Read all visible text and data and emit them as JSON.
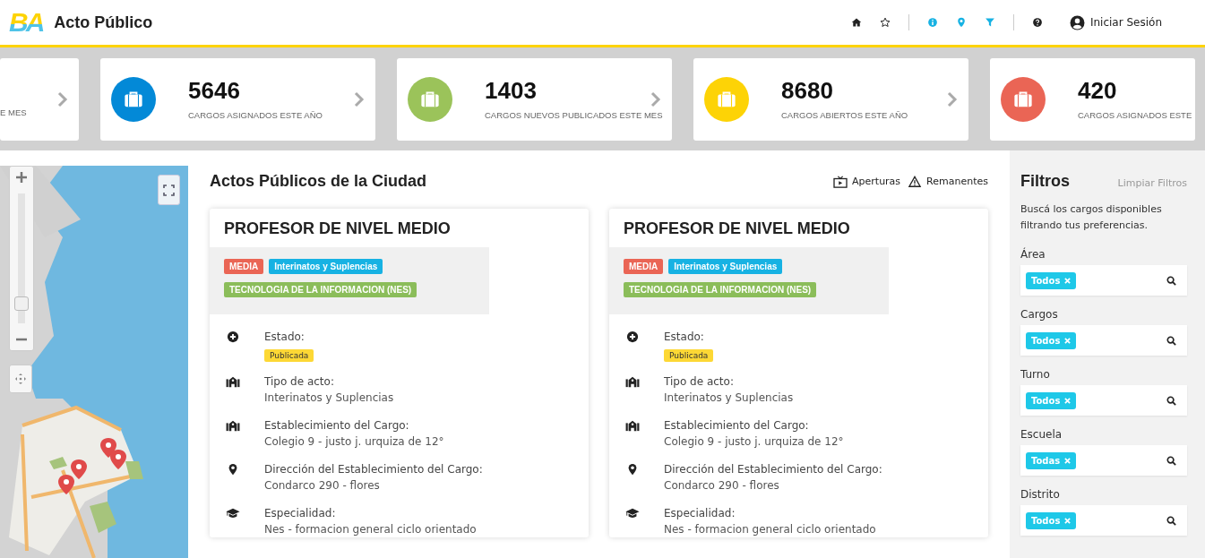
{
  "header": {
    "logo": "BA",
    "title": "Acto Público",
    "nav": [
      {
        "kind": "home"
      },
      {
        "kind": "star"
      },
      {
        "kind": "divider"
      },
      {
        "kind": "info"
      },
      {
        "kind": "pin"
      },
      {
        "kind": "filter"
      },
      {
        "kind": "divider"
      },
      {
        "kind": "help"
      }
    ],
    "login": "Iniciar Sesión"
  },
  "stats": [
    {
      "label": "E MES"
    },
    {
      "value": "5646",
      "label": "CARGOS ASIGNADOS ESTE AÑO",
      "color": "#0389d7"
    },
    {
      "value": "1403",
      "label": "CARGOS NUEVOS PUBLICADOS ESTE MES",
      "color": "#9bc35a"
    },
    {
      "value": "8680",
      "label": "CARGOS ABIERTOS ESTE AÑO",
      "color": "#fdd306"
    },
    {
      "value": "420",
      "label": "CARGOS ASIGNADOS ESTE",
      "color": "#ea6555"
    }
  ],
  "map": {
    "kind": "picture",
    "zoom": {
      "level": 0.1
    }
  },
  "main": {
    "title": "Actos Públicos de la Ciudad",
    "links": [
      {
        "kind": "tv",
        "label": "Aperturas"
      },
      {
        "kind": "warning",
        "label": "Remanentes"
      }
    ],
    "cards": [
      {
        "title": "PROFESOR DE NIVEL MEDIO",
        "tags": [
          {
            "label": "MEDIA",
            "color": "#ea6555"
          },
          {
            "label": "Interinatos y Suplencias",
            "color": "#17b2e3"
          },
          {
            "label": "TECNOLOGIA DE LA INFORMACION (NES)",
            "color": "#8bbd5a"
          }
        ],
        "fields": [
          {
            "kind": "status",
            "label": "Estado:",
            "badge": "Publicada"
          },
          {
            "kind": "building",
            "label": "Tipo de acto:",
            "value": "Interinatos y Suplencias"
          },
          {
            "kind": "building",
            "label": "Establecimiento del Cargo:",
            "value": "Colegio 9 - justo j. urquiza de 12°"
          },
          {
            "kind": "pin",
            "label": "Dirección del Establecimiento del Cargo:",
            "value": "Condarco 290 - flores"
          },
          {
            "kind": "cap",
            "label": "Especialidad:",
            "value": "Nes - formacion general ciclo orientado"
          }
        ]
      },
      {
        "title": "PROFESOR DE NIVEL MEDIO",
        "tags": [
          {
            "label": "MEDIA",
            "color": "#ea6555"
          },
          {
            "label": "Interinatos y Suplencias",
            "color": "#17b2e3"
          },
          {
            "label": "TECNOLOGIA DE LA INFORMACION (NES)",
            "color": "#8bbd5a"
          }
        ],
        "fields": [
          {
            "kind": "status",
            "label": "Estado:",
            "badge": "Publicada"
          },
          {
            "kind": "building",
            "label": "Tipo de acto:",
            "value": "Interinatos y Suplencias"
          },
          {
            "kind": "building",
            "label": "Establecimiento del Cargo:",
            "value": "Colegio 9 - justo j. urquiza de 12°"
          },
          {
            "kind": "pin",
            "label": "Dirección del Establecimiento del Cargo:",
            "value": "Condarco 290 - flores"
          },
          {
            "kind": "cap",
            "label": "Especialidad:",
            "value": "Nes - formacion general ciclo orientado"
          }
        ]
      }
    ]
  },
  "filters": {
    "title": "Filtros",
    "clear": "Limpiar Filtros",
    "description": "Buscá los cargos disponibles filtrando tus preferencias.",
    "groups": [
      {
        "label": "Área",
        "chip": "Todos"
      },
      {
        "label": "Cargos",
        "chip": "Todos"
      },
      {
        "label": "Turno",
        "chip": "Todos"
      },
      {
        "label": "Escuela",
        "chip": "Todas"
      },
      {
        "label": "Distrito",
        "chip": "Todos"
      }
    ]
  }
}
